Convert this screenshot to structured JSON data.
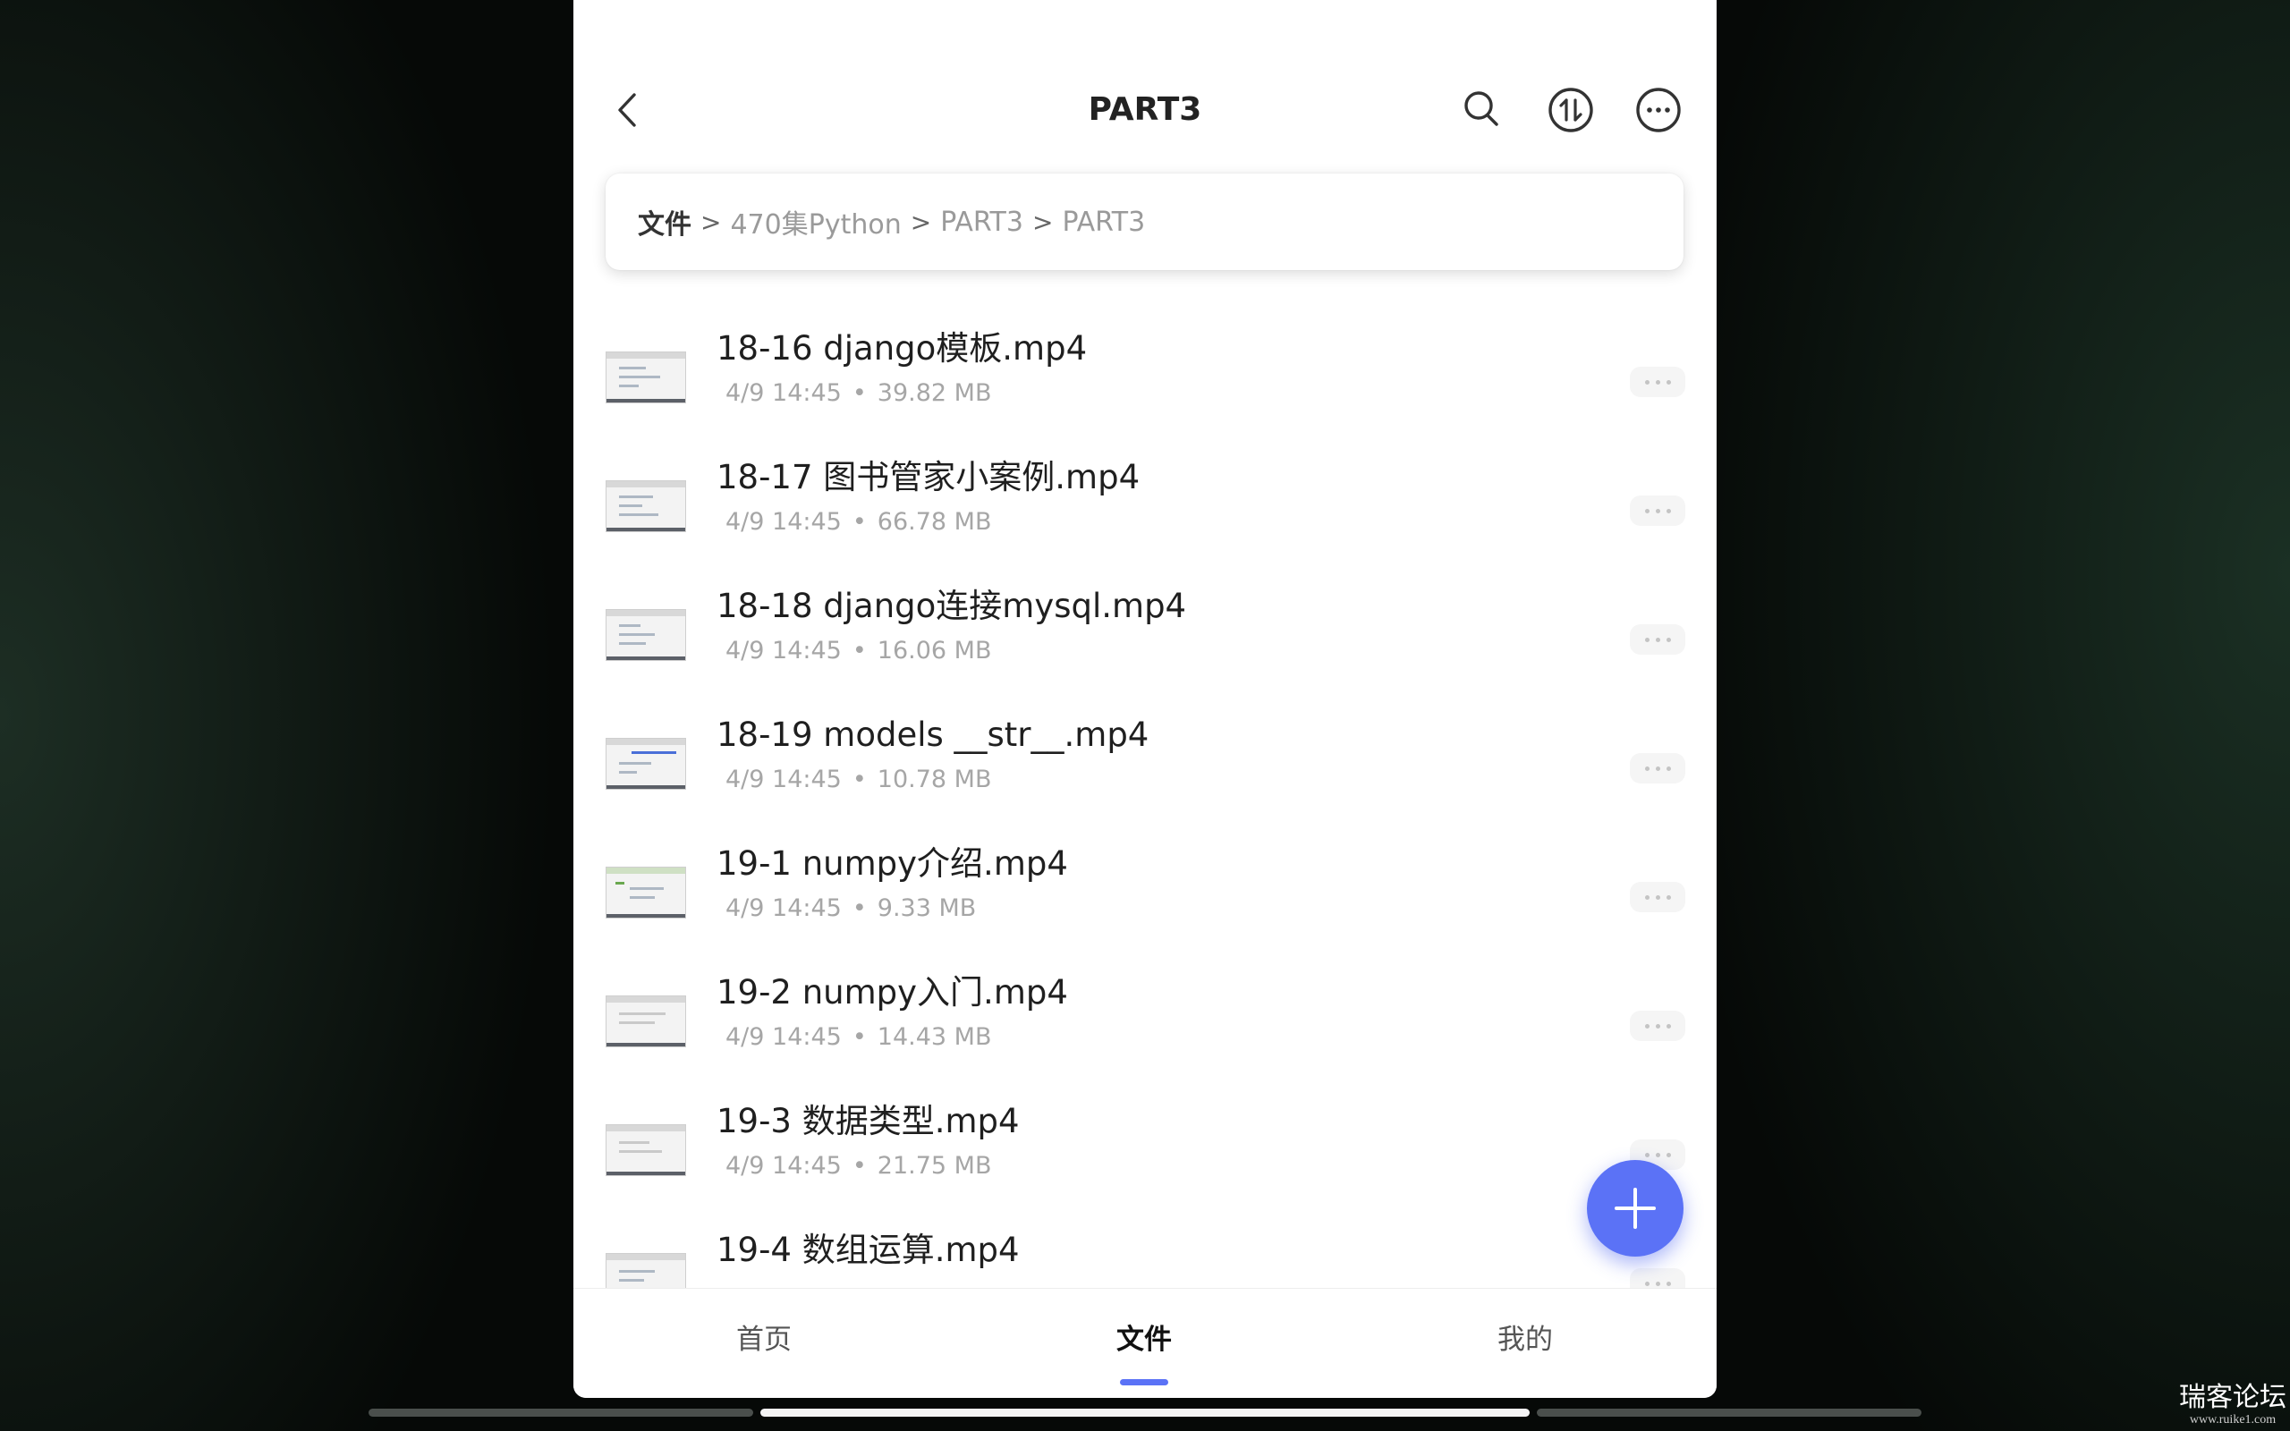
{
  "header": {
    "title": "PART3",
    "icons": [
      "back-icon",
      "search-icon",
      "sort-icon",
      "more-icon"
    ]
  },
  "breadcrumb": {
    "root": "文件",
    "items": [
      "470集Python",
      "PART3",
      "PART3"
    ],
    "separator": ">"
  },
  "files": [
    {
      "name": "18-16 django模板.mp4",
      "date": "4/9 14:45",
      "size": "39.82 MB"
    },
    {
      "name": "18-17 图书管家小案例.mp4",
      "date": "4/9 14:45",
      "size": "66.78 MB"
    },
    {
      "name": "18-18 django连接mysql.mp4",
      "date": "4/9 14:45",
      "size": "16.06 MB"
    },
    {
      "name": "18-19 models __str__.mp4",
      "date": "4/9 14:45",
      "size": "10.78 MB"
    },
    {
      "name": "19-1 numpy介绍.mp4",
      "date": "4/9 14:45",
      "size": "9.33 MB"
    },
    {
      "name": "19-2 numpy入门.mp4",
      "date": "4/9 14:45",
      "size": "14.43 MB"
    },
    {
      "name": "19-3 数据类型.mp4",
      "date": "4/9 14:45",
      "size": "21.75 MB"
    },
    {
      "name": "19-4 数组运算.mp4",
      "date": "",
      "size": ""
    }
  ],
  "meta_separator": "•",
  "fab": {
    "icon": "plus-icon"
  },
  "bottom_nav": {
    "tabs": [
      "首页",
      "文件",
      "我的"
    ],
    "active": "文件"
  },
  "watermark": {
    "main": "瑞客论坛",
    "sub": "www.ruike1.com"
  },
  "colors": {
    "accent": "#5b72f6",
    "text": "#1f1f1f",
    "meta": "#a6a6a6"
  }
}
